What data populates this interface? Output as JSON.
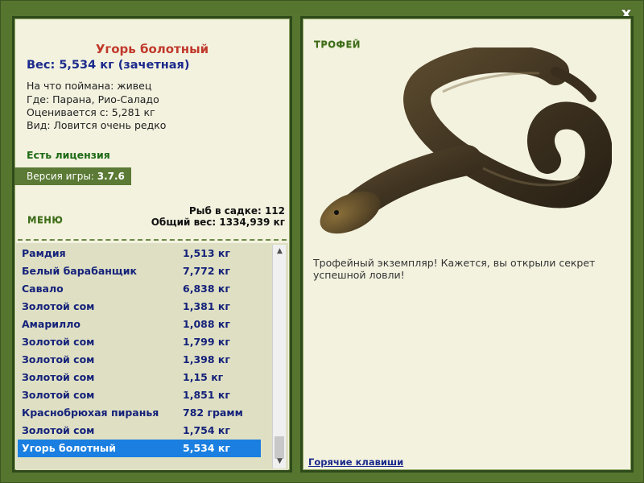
{
  "window": {
    "close_label": "x"
  },
  "fish_info": {
    "title": "Угорь болотный",
    "weight_line": "Вес: 5,534 кг (зачетная)",
    "caught_on": "На что поймана: живец",
    "location": "Где: Парана, Рио-Саладо",
    "rated_from": "Оценивается с: 5,281 кг",
    "rarity": "Вид: Ловится очень редко"
  },
  "license": "Есть лицензия",
  "version": {
    "label": "Версия игры: ",
    "value": "3.7.6"
  },
  "menu_label": "МЕНЮ",
  "keepnet": {
    "count_line": "Рыб в садке: 112",
    "total_line": "Общий вес: 1334,939 кг"
  },
  "catch_list": [
    {
      "name": "Рамдия",
      "weight": "1,513 кг"
    },
    {
      "name": "Белый барабанщик",
      "weight": "7,772 кг"
    },
    {
      "name": "Савало",
      "weight": "6,838 кг"
    },
    {
      "name": "Золотой сом",
      "weight": "1,381 кг"
    },
    {
      "name": "Амарилло",
      "weight": "1,088 кг"
    },
    {
      "name": "Золотой сом",
      "weight": "1,799 кг"
    },
    {
      "name": "Золотой сом",
      "weight": "1,398 кг"
    },
    {
      "name": "Золотой сом",
      "weight": "1,15 кг"
    },
    {
      "name": "Золотой сом",
      "weight": "1,851 кг"
    },
    {
      "name": "Краснобрюхая пиранья",
      "weight": "782 грамм"
    },
    {
      "name": "Золотой сом",
      "weight": "1,754 кг"
    },
    {
      "name": "Угорь болотный",
      "weight": "5,534 кг",
      "selected": true
    }
  ],
  "trophy": {
    "label": "ТРОФЕЙ",
    "text": "Трофейный экземпляр! Кажется, вы открыли секрет успешной ловли!"
  },
  "hotkeys_label": "Горячие клавиши",
  "colors": {
    "frame_green": "#56752f",
    "panel_bg": "#f3f2df",
    "selected_row": "#1a7fe0",
    "title_red": "#c0392b",
    "list_text": "#15227a"
  }
}
